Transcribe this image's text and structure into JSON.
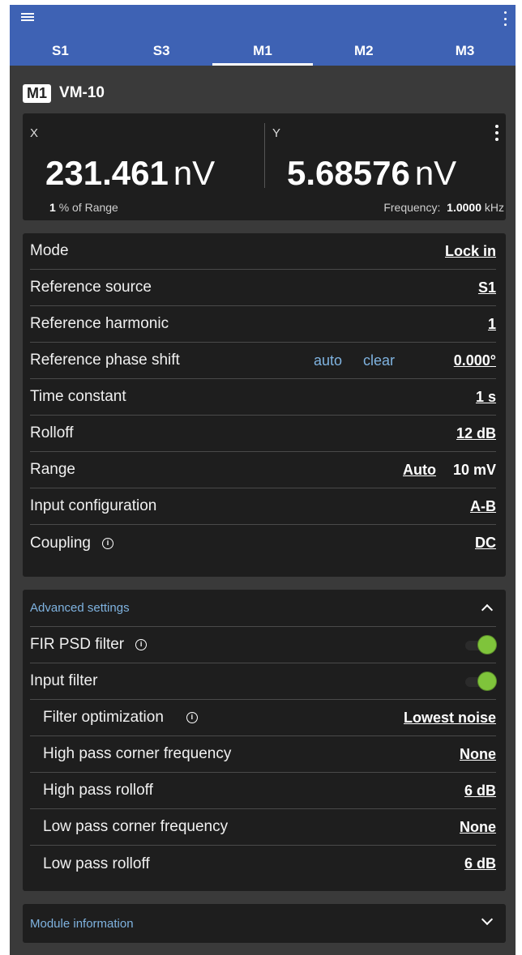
{
  "header": {
    "tabs": [
      {
        "label": "S1",
        "active": false
      },
      {
        "label": "S3",
        "active": false
      },
      {
        "label": "M1",
        "active": true
      },
      {
        "label": "M2",
        "active": false
      },
      {
        "label": "M3",
        "active": false
      }
    ]
  },
  "module": {
    "badge": "M1",
    "name": "VM-10"
  },
  "readout": {
    "x": {
      "label": "X",
      "value": "231.461",
      "unit": "nV"
    },
    "y": {
      "label": "Y",
      "value": "5.68576",
      "unit": "nV"
    },
    "range_pct": "1",
    "range_text": "% of Range",
    "freq_label": "Frequency:",
    "freq_value": "1.0000",
    "freq_unit": "kHz"
  },
  "settings": {
    "mode": {
      "label": "Mode",
      "value": "Lock in"
    },
    "ref_source": {
      "label": "Reference source",
      "value": "S1"
    },
    "ref_harmonic": {
      "label": "Reference harmonic",
      "value": "1"
    },
    "ref_phase": {
      "label": "Reference phase shift",
      "auto": "auto",
      "clear": "clear",
      "value": "0.000°"
    },
    "time_constant": {
      "label": "Time constant",
      "value": "1 s"
    },
    "rolloff": {
      "label": "Rolloff",
      "value": "12 dB"
    },
    "range": {
      "label": "Range",
      "auto": "Auto",
      "value": "10 mV"
    },
    "input_config": {
      "label": "Input configuration",
      "value": "A-B"
    },
    "coupling": {
      "label": "Coupling",
      "value": "DC"
    }
  },
  "advanced": {
    "title": "Advanced settings",
    "fir": {
      "label": "FIR PSD filter",
      "on": true
    },
    "input_filter": {
      "label": "Input filter",
      "on": true
    },
    "filter_opt": {
      "label": "Filter optimization",
      "value": "Lowest noise"
    },
    "hp_corner": {
      "label": "High pass corner frequency",
      "value": "None"
    },
    "hp_rolloff": {
      "label": "High pass rolloff",
      "value": "6 dB"
    },
    "lp_corner": {
      "label": "Low pass corner frequency",
      "value": "None"
    },
    "lp_rolloff": {
      "label": "Low pass rolloff",
      "value": "6 dB"
    }
  },
  "module_info": {
    "title": "Module information"
  },
  "colors": {
    "header": "#3e62b4",
    "background": "#3a3a3a",
    "card": "#1e1e1e",
    "accent_link": "#7fb3e0",
    "toggle_on": "#7fc43b"
  }
}
